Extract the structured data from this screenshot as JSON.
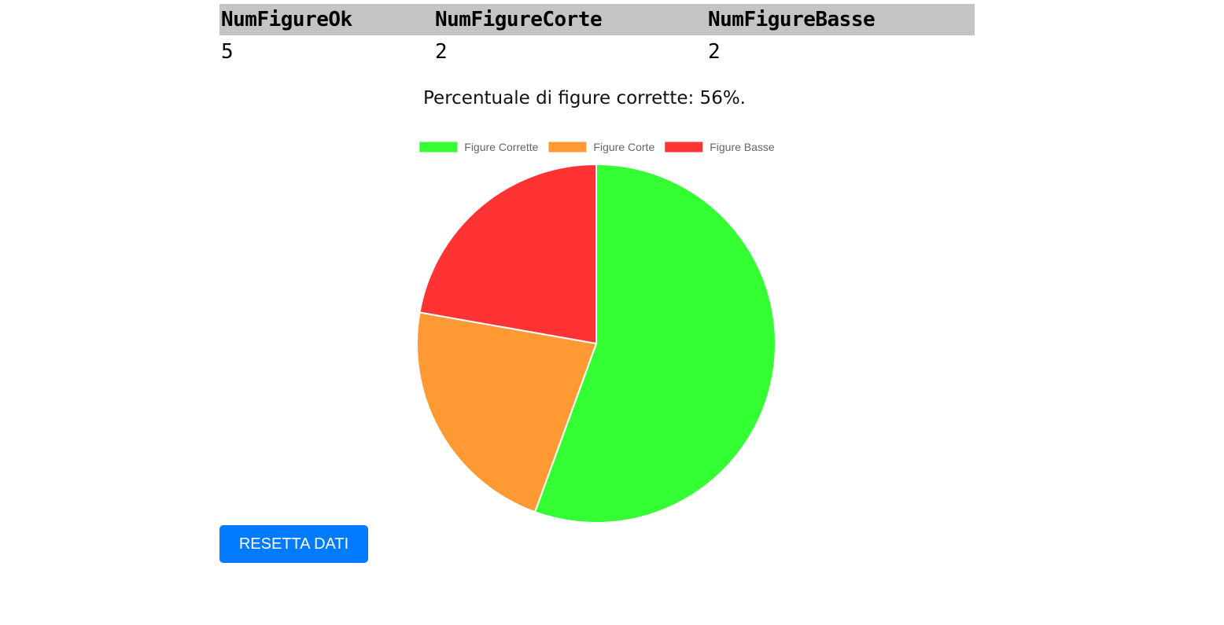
{
  "stats_table": {
    "headers": [
      "NumFigureOk",
      "NumFigureCorte",
      "NumFigureBasse"
    ],
    "values": [
      "5",
      "2",
      "2"
    ]
  },
  "percent_text": "Percentuale di figure corrette: 56%.",
  "reset_button_label": "RESETTA DATI",
  "chart_data": {
    "type": "pie",
    "categories": [
      "Figure Corrette",
      "Figure Corte",
      "Figure Basse"
    ],
    "values": [
      5,
      2,
      2
    ],
    "colors": [
      "#33ff33",
      "#ff9933",
      "#ff3333"
    ],
    "legend_position": "top",
    "title": ""
  }
}
